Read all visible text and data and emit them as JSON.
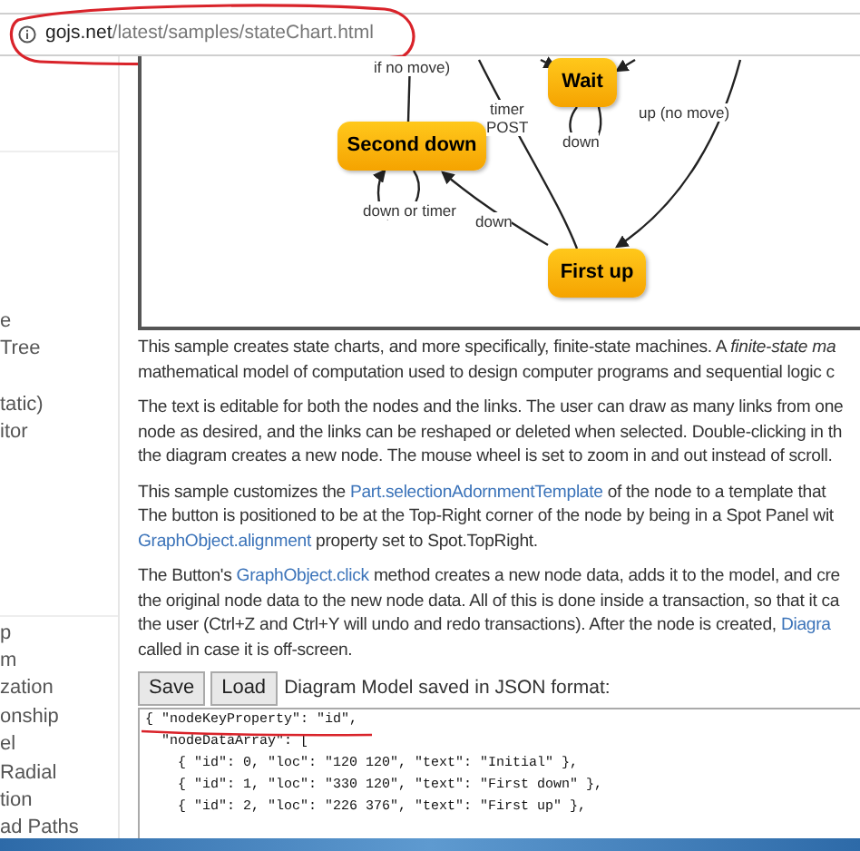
{
  "address_bar": {
    "domain": "gojs.net",
    "path": "/latest/samples/stateChart.html"
  },
  "sidebar": {
    "groups": [
      [
        "e",
        "Tree"
      ],
      [
        "tatic)",
        "itor"
      ],
      [
        "p",
        "m",
        "zation",
        "onship",
        "el",
        "Radial",
        "tion",
        "ad Paths"
      ]
    ]
  },
  "diagram": {
    "nodes": [
      {
        "text": "Wait"
      },
      {
        "text": "Second down"
      },
      {
        "text": "First up"
      }
    ],
    "link_labels": [
      "if no move)",
      "timer",
      "POST",
      "down",
      "up (no move)",
      "down or timer",
      "down"
    ]
  },
  "paragraphs": [
    [
      [
        {
          "text": "This sample creates state charts, and more specifically, finite-state machines. A "
        },
        {
          "text": "finite-state ma",
          "italic": true
        }
      ],
      [
        {
          "text": "mathematical model of computation used to design computer programs and sequential logic c"
        }
      ]
    ],
    [
      [
        {
          "text": "The text is editable for both the nodes and the links. The user can draw as many links from one"
        }
      ],
      [
        {
          "text": "node as desired, and the links can be reshaped or deleted when selected. Double-clicking in th"
        }
      ],
      [
        {
          "text": "the diagram creates a new node. The mouse wheel is set to zoom in and out instead of scroll."
        }
      ]
    ],
    [
      [
        {
          "text": "This sample customizes the "
        },
        {
          "text": "Part.selectionAdornmentTemplate",
          "link": true
        },
        {
          "text": " of the node to a template that"
        }
      ],
      [
        {
          "text": "The button is positioned to be at the Top-Right corner of the node by being in a Spot Panel wit"
        }
      ],
      [
        {
          "text": "GraphObject.alignment",
          "link": true
        },
        {
          "text": " property set to Spot.TopRight."
        }
      ]
    ],
    [
      [
        {
          "text": "The Button's "
        },
        {
          "text": "GraphObject.click",
          "link": true
        },
        {
          "text": " method creates a new node data, adds it to the model, and cre"
        }
      ],
      [
        {
          "text": "the original node data to the new node data. All of this is done inside a transaction, so that it ca"
        }
      ],
      [
        {
          "text": "the user (Ctrl+Z and Ctrl+Y will undo and redo transactions). After the node is created, "
        },
        {
          "text": "Diagra",
          "link": true
        }
      ],
      [
        {
          "text": "called in case it is off-screen."
        }
      ]
    ]
  ],
  "buttons": [
    "Save",
    "Load"
  ],
  "model_caption": "Diagram Model saved in JSON format:",
  "model_json": [
    "{ \"nodeKeyProperty\": \"id\",",
    "  \"nodeDataArray\": [",
    "    { \"id\": 0, \"loc\": \"120 120\", \"text\": \"Initial\" },",
    "    { \"id\": 1, \"loc\": \"330 120\", \"text\": \"First down\" },",
    "    { \"id\": 2, \"loc\": \"226 376\", \"text\": \"First up\" },"
  ]
}
